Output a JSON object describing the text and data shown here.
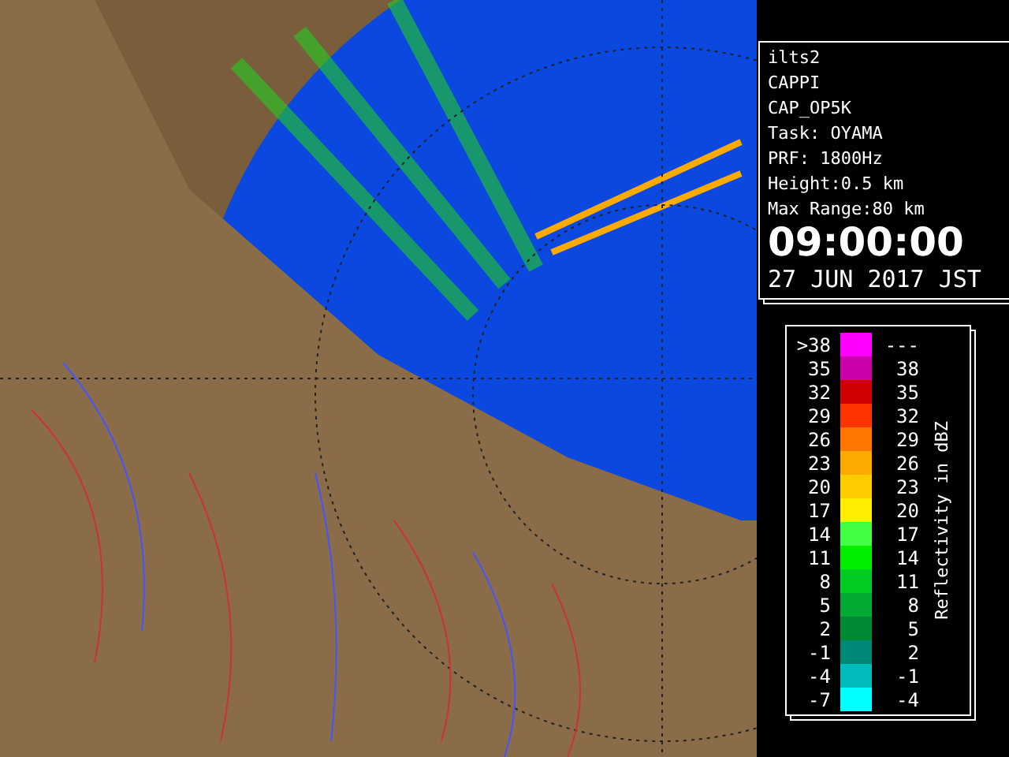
{
  "info_panel": {
    "lines": [
      "ilts2",
      "CAPPI",
      "CAP_OP5K",
      "Task: OYAMA",
      "PRF: 1800Hz",
      "Height:0.5 km",
      "Max Range:80 km"
    ],
    "time": "09:00:00",
    "date": "27 JUN 2017 JST"
  },
  "legend": {
    "title": "Reflectivity in dBZ",
    "rows": [
      {
        "low": ">38",
        "high": "---",
        "color": "#ff00ff"
      },
      {
        "low": "35",
        "high": "38",
        "color": "#cc00aa"
      },
      {
        "low": "32",
        "high": "35",
        "color": "#d00000"
      },
      {
        "low": "29",
        "high": "32",
        "color": "#ff3300"
      },
      {
        "low": "26",
        "high": "29",
        "color": "#ff7700"
      },
      {
        "low": "23",
        "high": "26",
        "color": "#ffaa00"
      },
      {
        "low": "20",
        "high": "23",
        "color": "#ffcc00"
      },
      {
        "low": "17",
        "high": "20",
        "color": "#ffee00"
      },
      {
        "low": "14",
        "high": "17",
        "color": "#44ff44"
      },
      {
        "low": "11",
        "high": "14",
        "color": "#00ee00"
      },
      {
        "low": "8",
        "high": "11",
        "color": "#00cc22"
      },
      {
        "low": "5",
        "high": "8",
        "color": "#00aa33"
      },
      {
        "low": "2",
        "high": "5",
        "color": "#008833"
      },
      {
        "low": "-1",
        "high": "2",
        "color": "#008877"
      },
      {
        "low": "-4",
        "high": "-1",
        "color": "#00bbbb"
      },
      {
        "low": "-7",
        "high": "-4",
        "color": "#00ffff"
      }
    ]
  }
}
